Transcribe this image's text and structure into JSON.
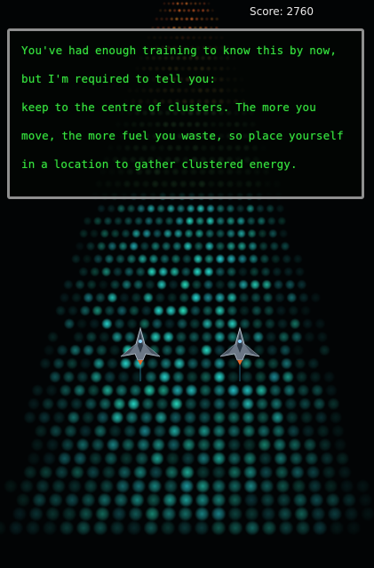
{
  "hud": {
    "score_label": "Score: 2760"
  },
  "dialog": {
    "lines": [
      "You've had enough training to know this by now, but I'm required to tell you:",
      "keep to the centre of clusters. The more you move, the more fuel you waste, so place yourself in a location to gather clustered energy."
    ]
  },
  "colors": {
    "dialog_text": "#37e43f",
    "dialog_border": "#8f8f8f",
    "energy_near": "#2ed9d0",
    "energy_far": "#e2532b"
  },
  "icons": {
    "player_ship": "starfighter-ship-icon",
    "wingman_ship": "starfighter-ship-icon"
  }
}
